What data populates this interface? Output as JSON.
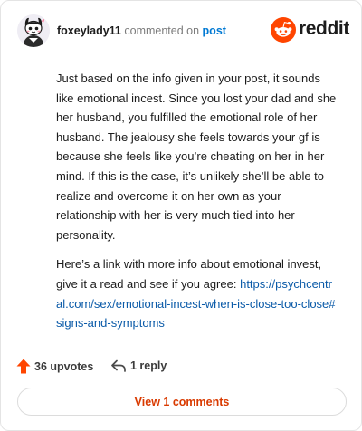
{
  "header": {
    "username": "foxeylady11",
    "action_text": "commented on",
    "post_label": "post",
    "avatar_icon": "snoo-avatar-icon"
  },
  "brand": {
    "icon": "reddit-alien-icon",
    "name": "reddit",
    "color": "#ff4500"
  },
  "comment": {
    "paragraphs": [
      "Just based on the info given in your post, it sounds like emotional incest. Since you lost your dad and she her husband, you fulfilled the emotional role of her husband. The jealousy she feels towards your gf is because she feels like you’re cheating on her in her mind. If this is the case, it’s unlikely she’ll be able to realize and overcome it on her own as your relationship with her is very much tied into her personality.",
      "Here’s a link with more info about emotional invest, give it a read and see if you agree:"
    ],
    "link": "https://psychcentral.com/sex/emotional-incest-when-is-close-too-close#signs-and-symptoms"
  },
  "actions": {
    "upvote_icon": "upvote-arrow-icon",
    "upvotes_label": "36 upvotes",
    "reply_icon": "reply-arrow-icon",
    "replies_label": "1 reply"
  },
  "footer": {
    "view_comments_label": "View 1 comments",
    "accent_color": "#d93a00"
  },
  "colors": {
    "upvote": "#ff4500",
    "link": "#0a5aa8",
    "post_link": "#0079d3"
  }
}
